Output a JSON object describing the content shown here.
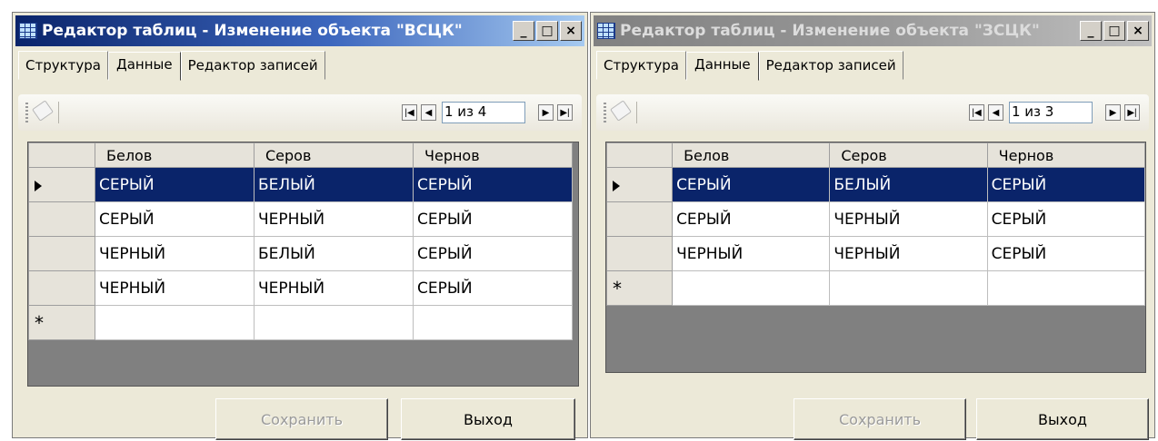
{
  "windows": [
    {
      "title": "Редактор таблиц  -  Изменение объекта \"ВСЦК\"",
      "tabs": [
        "Структура",
        "Данные",
        "Редактор записей"
      ],
      "position": "1 из 4",
      "columns": [
        "Белов",
        "Серов",
        "Чернов"
      ],
      "rows": [
        [
          "СЕРЫЙ",
          "БЕЛЫЙ",
          "СЕРЫЙ"
        ],
        [
          "СЕРЫЙ",
          "ЧЕРНЫЙ",
          "СЕРЫЙ"
        ],
        [
          "ЧЕРНЫЙ",
          "БЕЛЫЙ",
          "СЕРЫЙ"
        ],
        [
          "ЧЕРНЫЙ",
          "ЧЕРНЫЙ",
          "СЕРЫЙ"
        ]
      ],
      "new_row_marker": "*",
      "save_label": "Сохранить",
      "exit_label": "Выход"
    },
    {
      "title": "Редактор таблиц  -  Изменение объекта \"ЗСЦК\"",
      "tabs": [
        "Структура",
        "Данные",
        "Редактор записей"
      ],
      "position": "1 из 3",
      "columns": [
        "Белов",
        "Серов",
        "Чернов"
      ],
      "rows": [
        [
          "СЕРЫЙ",
          "БЕЛЫЙ",
          "СЕРЫЙ"
        ],
        [
          "СЕРЫЙ",
          "ЧЕРНЫЙ",
          "СЕРЫЙ"
        ],
        [
          "ЧЕРНЫЙ",
          "ЧЕРНЫЙ",
          "СЕРЫЙ"
        ]
      ],
      "new_row_marker": "*",
      "save_label": "Сохранить",
      "exit_label": "Выход"
    }
  ],
  "title_buttons": {
    "minimize": "_",
    "maximize": "□",
    "close": "×"
  },
  "colors": {
    "selection": "#0a246a",
    "active_title": "#0a246a",
    "inactive_title": "#808080",
    "face": "#ece9d8"
  }
}
